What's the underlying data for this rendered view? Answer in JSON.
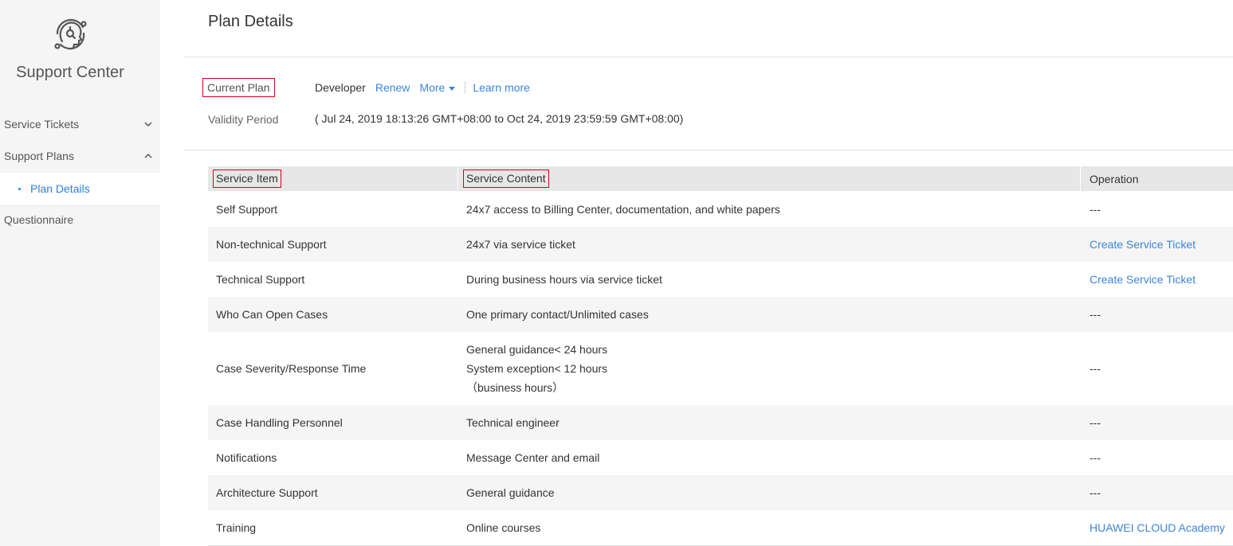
{
  "sidebar": {
    "brand": "Support Center",
    "items": [
      {
        "label": "Service Tickets"
      },
      {
        "label": "Support Plans"
      },
      {
        "label": "Plan Details"
      },
      {
        "label": "Questionnaire"
      }
    ]
  },
  "page": {
    "title": "Plan Details"
  },
  "plan": {
    "current_label": "Current Plan",
    "current_value": "Developer",
    "renew": "Renew",
    "more": "More",
    "learn_more": "Learn more",
    "validity_label": "Validity Period",
    "validity_value": "( Jul 24, 2019 18:13:26 GMT+08:00 to Oct 24, 2019 23:59:59 GMT+08:00)"
  },
  "table": {
    "headers": [
      "Service Item",
      "Service Content",
      "Operation"
    ],
    "rows": [
      {
        "item": "Self Support",
        "content": "24x7 access to Billing Center, documentation, and white papers",
        "op": "---",
        "op_link": false
      },
      {
        "item": "Non-technical Support",
        "content": "24x7 via service ticket",
        "op": "Create Service Ticket",
        "op_link": true
      },
      {
        "item": "Technical Support",
        "content": "During business hours via service ticket",
        "op": "Create Service Ticket",
        "op_link": true
      },
      {
        "item": "Who Can Open Cases",
        "content": "One primary contact/Unlimited cases",
        "op": "---",
        "op_link": false
      },
      {
        "item": "Case Severity/Response Time",
        "content_lines": [
          "General guidance< 24 hours",
          "System exception< 12 hours",
          "（business hours）"
        ],
        "op": "---",
        "op_link": false
      },
      {
        "item": "Case Handling Personnel",
        "content": "Technical engineer",
        "op": "---",
        "op_link": false
      },
      {
        "item": "Notifications",
        "content": "Message Center and email",
        "op": "---",
        "op_link": false
      },
      {
        "item": "Architecture Support",
        "content": "General guidance",
        "op": "---",
        "op_link": false
      },
      {
        "item": "Training",
        "content": "Online courses",
        "op": "HUAWEI CLOUD Academy",
        "op_link": true
      }
    ]
  },
  "colors": {
    "accent": "#3b86d8",
    "highlight_box": "#d9001b"
  },
  "icons": {
    "logo": "support-head-icon",
    "collapse": "chevron-down-icon",
    "expand": "chevron-up-icon"
  }
}
